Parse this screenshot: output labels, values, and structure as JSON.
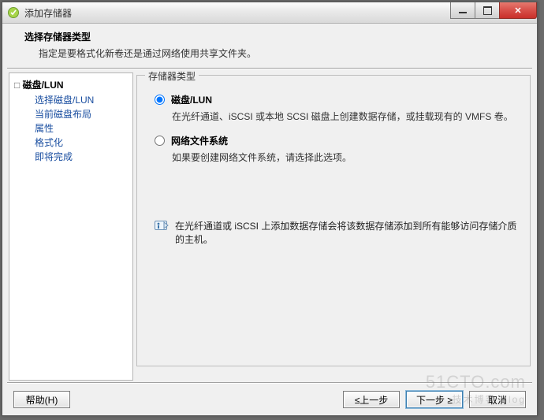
{
  "window": {
    "title": "添加存储器"
  },
  "header": {
    "title": "选择存储器类型",
    "subtitle": "指定是要格式化新卷还是通过网络使用共享文件夹。"
  },
  "nav": {
    "group": "磁盘/LUN",
    "items": [
      "选择磁盘/LUN",
      "当前磁盘布局",
      "属性",
      "格式化",
      "即将完成"
    ]
  },
  "content": {
    "groupbox_title": "存储器类型",
    "option_disk": {
      "label": "磁盘/LUN",
      "desc": "在光纤通道、iSCSI 或本地 SCSI 磁盘上创建数据存储，或挂载现有的 VMFS 卷。",
      "selected": true
    },
    "option_nfs": {
      "label": "网络文件系统",
      "desc": "如果要创建网络文件系统，请选择此选项。",
      "selected": false
    },
    "info_text": "在光纤通道或 iSCSI 上添加数据存储会将该数据存储添加到所有能够访问存储介质的主机。"
  },
  "footer": {
    "help": "帮助(H)",
    "back": "≤上一步",
    "next": "下一步 ≥",
    "cancel": "取消"
  },
  "watermark": {
    "main": "51CTO.com",
    "sub": "技术博客 Blog"
  }
}
